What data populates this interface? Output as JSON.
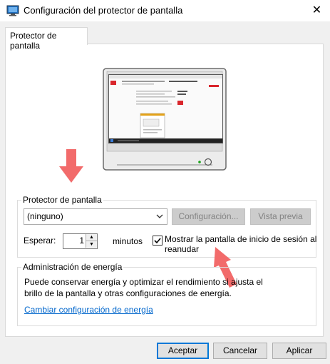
{
  "window": {
    "title": "Configuración del protector de pantalla",
    "close_glyph": "✕"
  },
  "tabs": [
    {
      "label": "Protector de pantalla",
      "active": true
    }
  ],
  "screensaver_group": {
    "legend": "Protector de pantalla",
    "selected": "(ninguno)",
    "settings_button": "Configuración...",
    "preview_button": "Vista previa",
    "wait_label": "Esperar:",
    "wait_value": "1",
    "minutes_label": "minutos",
    "resume_checkbox": {
      "label_line1": "Mostrar la pantalla de inicio de sesión al",
      "label_line2": "reanudar",
      "checked": true
    }
  },
  "power_group": {
    "legend": "Administración de energía",
    "description_line1": "Puede conservar energía y optimizar el rendimiento si ajusta el",
    "description_line2": "brillo de la pantalla y otras configuraciones de energía.",
    "link": "Cambiar configuración de energía"
  },
  "footer": {
    "ok": "Aceptar",
    "cancel": "Cancelar",
    "apply": "Aplicar"
  },
  "colors": {
    "annotation_arrow": "#f26b6b",
    "link": "#0066cc",
    "accent": "#0078d7"
  },
  "icons": [
    "screensaver-app-icon",
    "close-icon",
    "chevron-down-icon",
    "spin-up-icon",
    "spin-down-icon",
    "checkmark-icon",
    "power-button-icon"
  ]
}
